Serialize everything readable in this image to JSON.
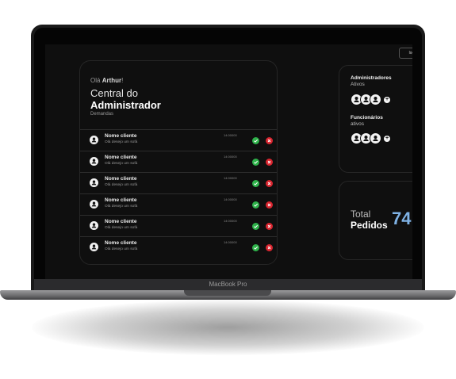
{
  "device_label": "MacBook Pro",
  "header": {
    "login_label": "log"
  },
  "greeting": {
    "prefix": "Olá",
    "name": "Arthur",
    "suffix": "!"
  },
  "title": {
    "line1": "Central do",
    "line2": "Administrador"
  },
  "section_label": "Demandas",
  "demands": [
    {
      "name": "Nome cliente",
      "message": "Olá desejo um sofá",
      "time": "14:00000"
    },
    {
      "name": "Nome cliente",
      "message": "Olá desejo um sofá",
      "time": "14:00000"
    },
    {
      "name": "Nome cliente",
      "message": "Olá desejo um sofá",
      "time": "14:00000"
    },
    {
      "name": "Nome cliente",
      "message": "Olá desejo um sofá",
      "time": "14:00000"
    },
    {
      "name": "Nome cliente",
      "message": "Olá desejo um sofá",
      "time": "14:00000"
    },
    {
      "name": "Nome cliente",
      "message": "Olá desejo um sofá",
      "time": "14:00000"
    }
  ],
  "admins": {
    "title": "Administradores",
    "subtitle": "Ativos",
    "avatar_count": 3,
    "add_icon": "plus-icon"
  },
  "employees": {
    "title": "Funcionários",
    "subtitle": "ativos",
    "avatar_count": 3,
    "add_icon": "plus-icon"
  },
  "totals": {
    "label1": "Total",
    "label2": "Pedidos",
    "value": "74"
  },
  "colors": {
    "accept": "#2eb24a",
    "reject": "#d9252f",
    "total_accent": "#7fb2e5",
    "background": "#0f0f0f"
  }
}
